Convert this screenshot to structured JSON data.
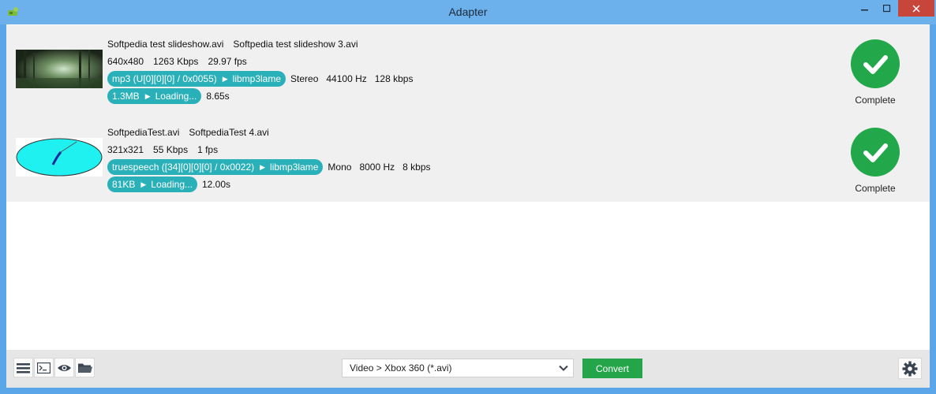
{
  "window": {
    "title": "Adapter"
  },
  "rows": [
    {
      "source_file": "Softpedia test slideshow.avi",
      "output_file": "Softpedia test slideshow 3.avi",
      "resolution": "640x480",
      "bitrate": "1263 Kbps",
      "fps": "29.97 fps",
      "codec_in": "mp3 (U[0][0][0] / 0x0055)",
      "codec_out": "libmp3lame",
      "channels": "Stereo",
      "sample_rate": "44100 Hz",
      "audio_bitrate": "128 kbps",
      "size": "1.3MB",
      "progress_text": "Loading...",
      "duration": "8.65s",
      "status": "Complete"
    },
    {
      "source_file": "SoftpediaTest.avi",
      "output_file": "SoftpediaTest 4.avi",
      "resolution": "321x321",
      "bitrate": "55 Kbps",
      "fps": "1 fps",
      "codec_in": "truespeech ([34][0][0][0] / 0x0022)",
      "codec_out": "libmp3lame",
      "channels": "Mono",
      "sample_rate": "8000 Hz",
      "audio_bitrate": "8 kbps",
      "size": "81KB",
      "progress_text": "Loading...",
      "duration": "12.00s",
      "status": "Complete"
    }
  ],
  "toolbar": {
    "preset_value": "Video > Xbox 360 (*.avi)",
    "convert_label": "Convert"
  },
  "icons": {
    "menu": "hamburger-icon",
    "terminal": "terminal-icon",
    "preview": "eye-icon",
    "folder": "folder-icon",
    "settings": "gear-icon",
    "status": "checkmark-icon"
  },
  "colors": {
    "titlebar": "#6cb0ec",
    "pill": "#29b0b8",
    "success": "#22a84a",
    "close": "#c7453a"
  }
}
